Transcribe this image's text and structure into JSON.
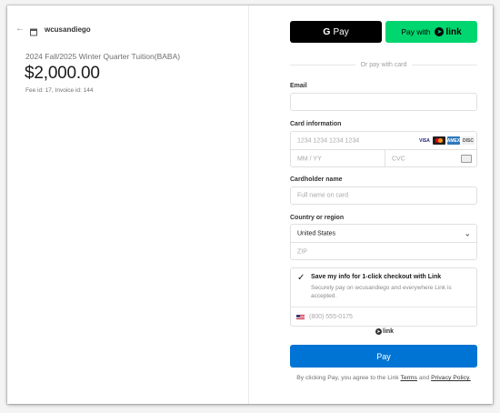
{
  "merchant": {
    "name": "wcusandiego"
  },
  "summary": {
    "product": "2024 Fall/2025 Winter Quarter Tuition(BABA)",
    "amount": "$2,000.00",
    "fee_info": "Fee id: 17, Invoice id: 144"
  },
  "express": {
    "gpay_g": "G",
    "gpay_label": "Pay",
    "link_prefix": "Pay with",
    "link_word": "link",
    "divider": "Or pay with card"
  },
  "form": {
    "email_label": "Email",
    "card_label": "Card information",
    "card_number_ph": "1234 1234 1234 1234",
    "expiry_ph": "MM / YY",
    "cvc_ph": "CVC",
    "brands": [
      "VISA",
      "",
      "AMEX",
      "DISC"
    ],
    "name_label": "Cardholder name",
    "name_ph": "Full name on card",
    "country_label": "Country or region",
    "country_value": "United States",
    "zip_ph": "ZIP"
  },
  "link_save": {
    "title": "Save my info for 1-click checkout with Link",
    "desc": "Securely pay on wcusandiego and everywhere Link is accepted.",
    "phone_ph": "(800) 555-0175",
    "link_mark": "link"
  },
  "pay": {
    "label": "Pay",
    "terms_prefix": "By clicking Pay, you agree to the Link",
    "terms_link": "Terms",
    "terms_and": "and",
    "privacy_link": "Privacy Policy."
  },
  "colors": {
    "pay": "#0074d4",
    "link": "#00d66f",
    "gpay": "#000000"
  }
}
